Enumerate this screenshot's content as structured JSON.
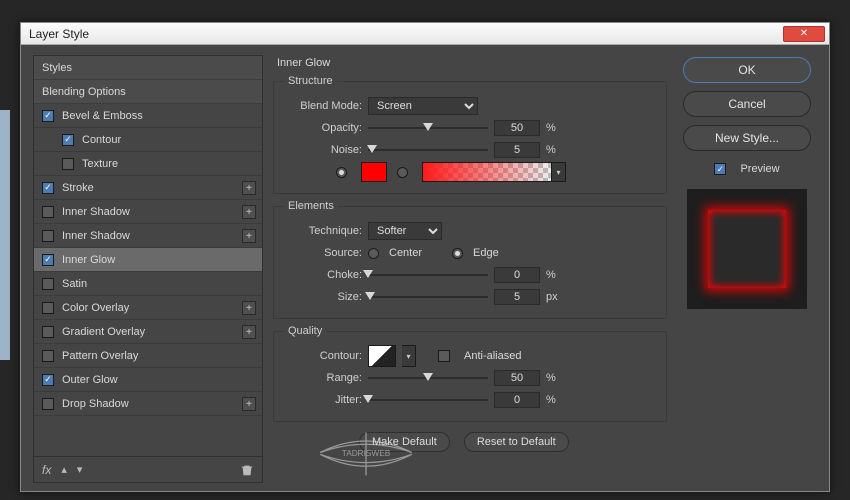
{
  "window": {
    "title": "Layer Style"
  },
  "buttons": {
    "ok": "OK",
    "cancel": "Cancel",
    "newStyle": "New Style...",
    "preview": "Preview",
    "makeDefault": "Make Default",
    "resetDefault": "Reset to Default"
  },
  "sidebar": {
    "header1": "Styles",
    "header2": "Blending Options",
    "items": [
      {
        "label": "Bevel & Emboss",
        "checked": true,
        "plus": false
      },
      {
        "label": "Contour",
        "checked": true,
        "plus": false,
        "child": true
      },
      {
        "label": "Texture",
        "checked": false,
        "plus": false,
        "child": true
      },
      {
        "label": "Stroke",
        "checked": true,
        "plus": true
      },
      {
        "label": "Inner Shadow",
        "checked": false,
        "plus": true
      },
      {
        "label": "Inner Shadow",
        "checked": false,
        "plus": true
      },
      {
        "label": "Inner Glow",
        "checked": true,
        "plus": false,
        "selected": true
      },
      {
        "label": "Satin",
        "checked": false,
        "plus": false
      },
      {
        "label": "Color Overlay",
        "checked": false,
        "plus": true
      },
      {
        "label": "Gradient Overlay",
        "checked": false,
        "plus": true
      },
      {
        "label": "Pattern Overlay",
        "checked": false,
        "plus": false
      },
      {
        "label": "Outer Glow",
        "checked": true,
        "plus": false
      },
      {
        "label": "Drop Shadow",
        "checked": false,
        "plus": true
      }
    ],
    "footer_fx": "fx"
  },
  "panel": {
    "title": "Inner Glow",
    "structure": {
      "legend": "Structure",
      "blendModeLabel": "Blend Mode:",
      "blendMode": "Screen",
      "opacityLabel": "Opacity:",
      "opacity": "50",
      "opacityUnit": "%",
      "noiseLabel": "Noise:",
      "noise": "5",
      "noiseUnit": "%",
      "colorHex": "#ff0000",
      "colorMode": "solid"
    },
    "elements": {
      "legend": "Elements",
      "techniqueLabel": "Technique:",
      "technique": "Softer",
      "sourceLabel": "Source:",
      "sourceCenter": "Center",
      "sourceEdge": "Edge",
      "source": "edge",
      "chokeLabel": "Choke:",
      "choke": "0",
      "chokeUnit": "%",
      "sizeLabel": "Size:",
      "size": "5",
      "sizeUnit": "px"
    },
    "quality": {
      "legend": "Quality",
      "contourLabel": "Contour:",
      "antiLabel": "Anti-aliased",
      "anti": false,
      "rangeLabel": "Range:",
      "range": "50",
      "rangeUnit": "%",
      "jitterLabel": "Jitter:",
      "jitter": "0",
      "jitterUnit": "%"
    }
  },
  "watermark": "TADRISWEB"
}
